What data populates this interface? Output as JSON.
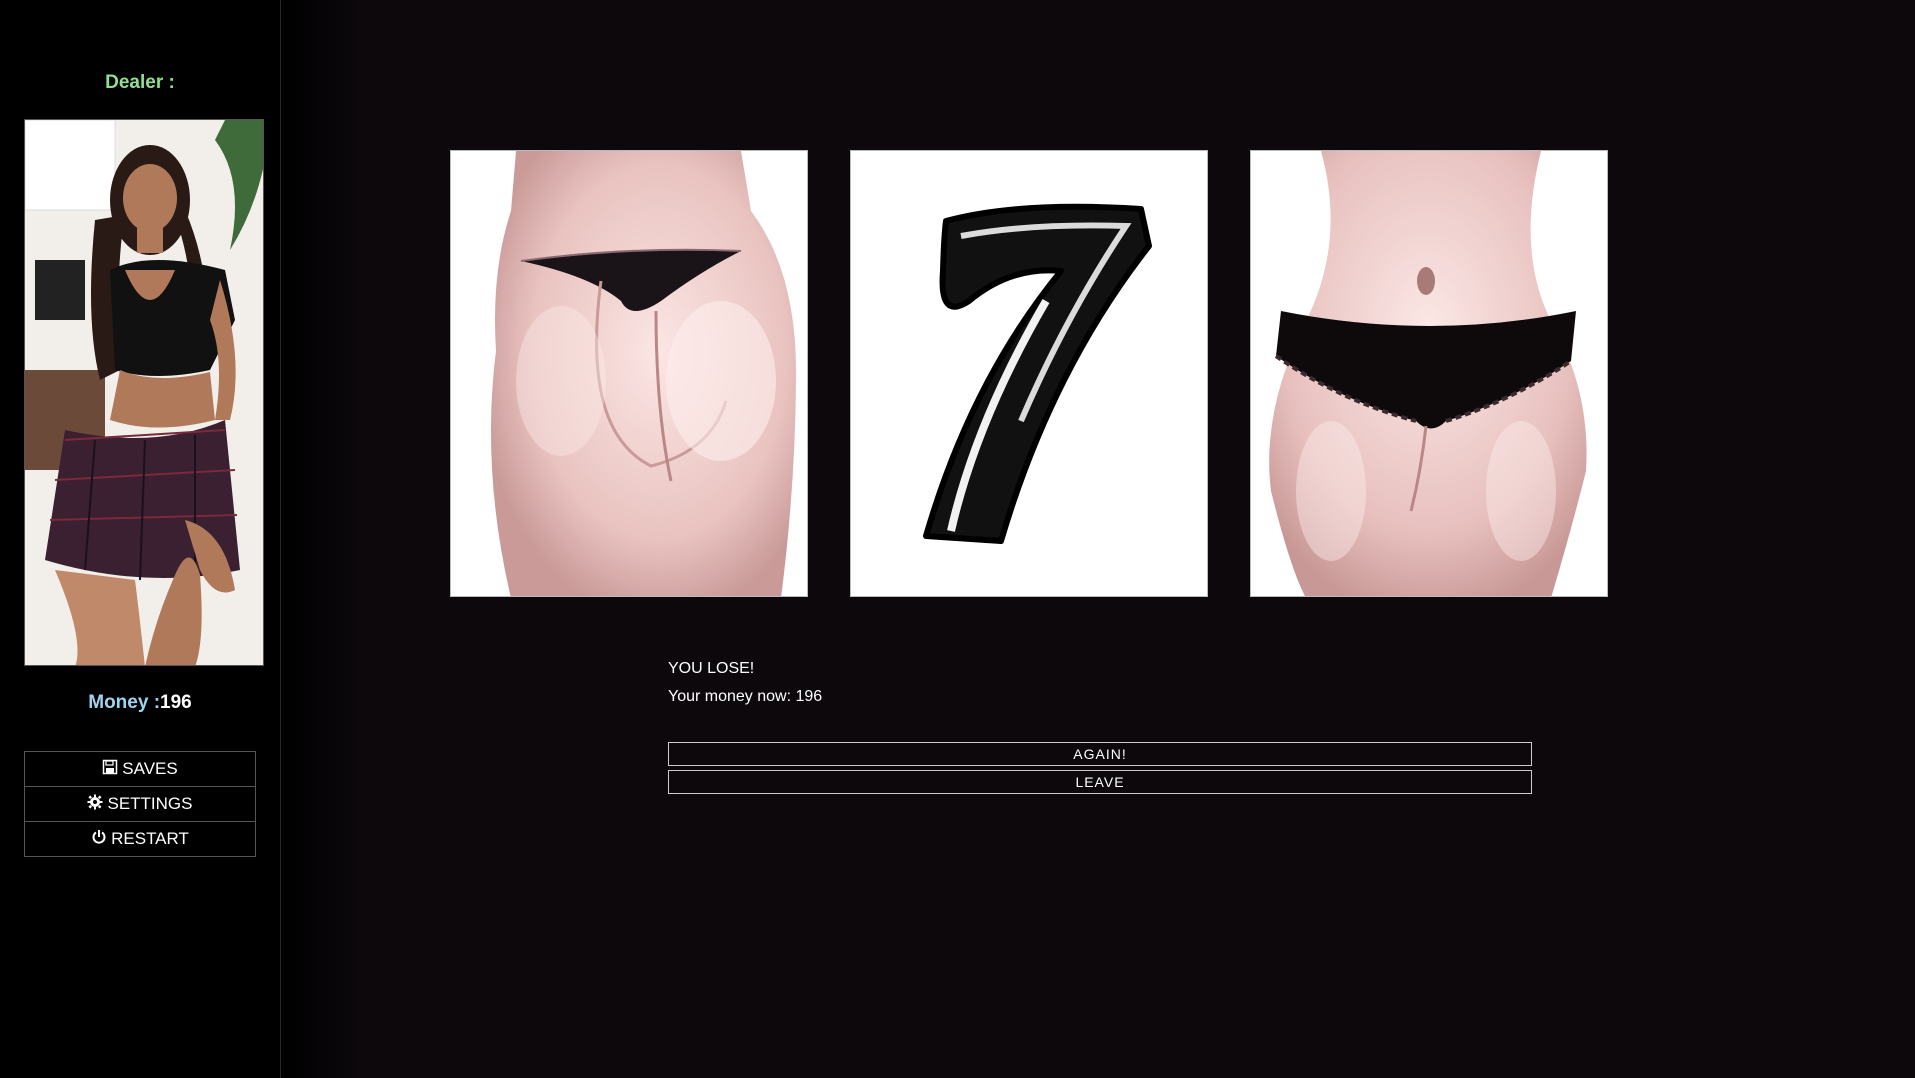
{
  "sidebar": {
    "dealer_label": "Dealer :",
    "money_label": "Money :",
    "money_value": "196",
    "menu": {
      "saves_label": "SAVES",
      "settings_label": "SETTINGS",
      "restart_label": "RESTART"
    }
  },
  "reels": [
    {
      "symbol": "peach"
    },
    {
      "symbol": "7",
      "text": "7"
    },
    {
      "symbol": "panties"
    }
  ],
  "result": {
    "status": "YOU LOSE!",
    "money_text": "Your money now: 196"
  },
  "actions": {
    "again_label": "AGAIN!",
    "leave_label": "LEAVE"
  },
  "colors": {
    "dealer_label": "#8fe08f",
    "money_label": "#9fd4f0",
    "background": "#0c080c"
  }
}
